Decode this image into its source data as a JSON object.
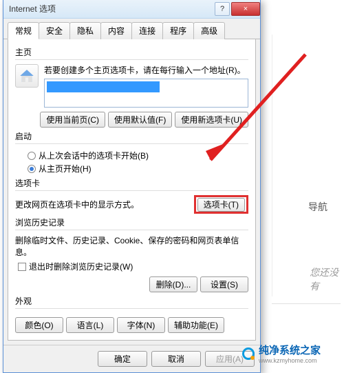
{
  "window": {
    "title": "Internet 选项",
    "help_symbol": "?",
    "close_symbol": "×"
  },
  "tabs": [
    "常规",
    "安全",
    "隐私",
    "内容",
    "连接",
    "程序",
    "高级"
  ],
  "active_tab_index": 0,
  "homepage": {
    "label": "主页",
    "desc": "若要创建多个主页选项卡，请在每行输入一个地址(R)。",
    "url_masked": "████████████",
    "buttons": {
      "use_current": "使用当前页(C)",
      "use_default": "使用默认值(F)",
      "use_new_tab": "使用新选项卡(U)"
    }
  },
  "startup": {
    "label": "启动",
    "opt_last": "从上次会话中的选项卡开始(B)",
    "opt_home": "从主页开始(H)",
    "selected": "home"
  },
  "tabs_section": {
    "label": "选项卡",
    "desc": "更改网页在选项卡中的显示方式。",
    "button": "选项卡(T)"
  },
  "history": {
    "label": "浏览历史记录",
    "desc": "删除临时文件、历史记录、Cookie、保存的密码和网页表单信息。",
    "exit_delete": "退出时删除浏览历史记录(W)",
    "buttons": {
      "delete": "删除(D)...",
      "settings": "设置(S)"
    }
  },
  "appearance": {
    "label": "外观",
    "buttons": {
      "colors": "颜色(O)",
      "languages": "语言(L)",
      "fonts": "字体(N)",
      "accessibility": "辅助功能(E)"
    }
  },
  "footer": {
    "ok": "确定",
    "cancel": "取消",
    "apply": "应用(A)"
  },
  "background": {
    "nav_label": "导航",
    "hint_text": "您还没有",
    "watermark_name": "纯净系统之家",
    "watermark_url": "www.kzmyhome.com"
  }
}
